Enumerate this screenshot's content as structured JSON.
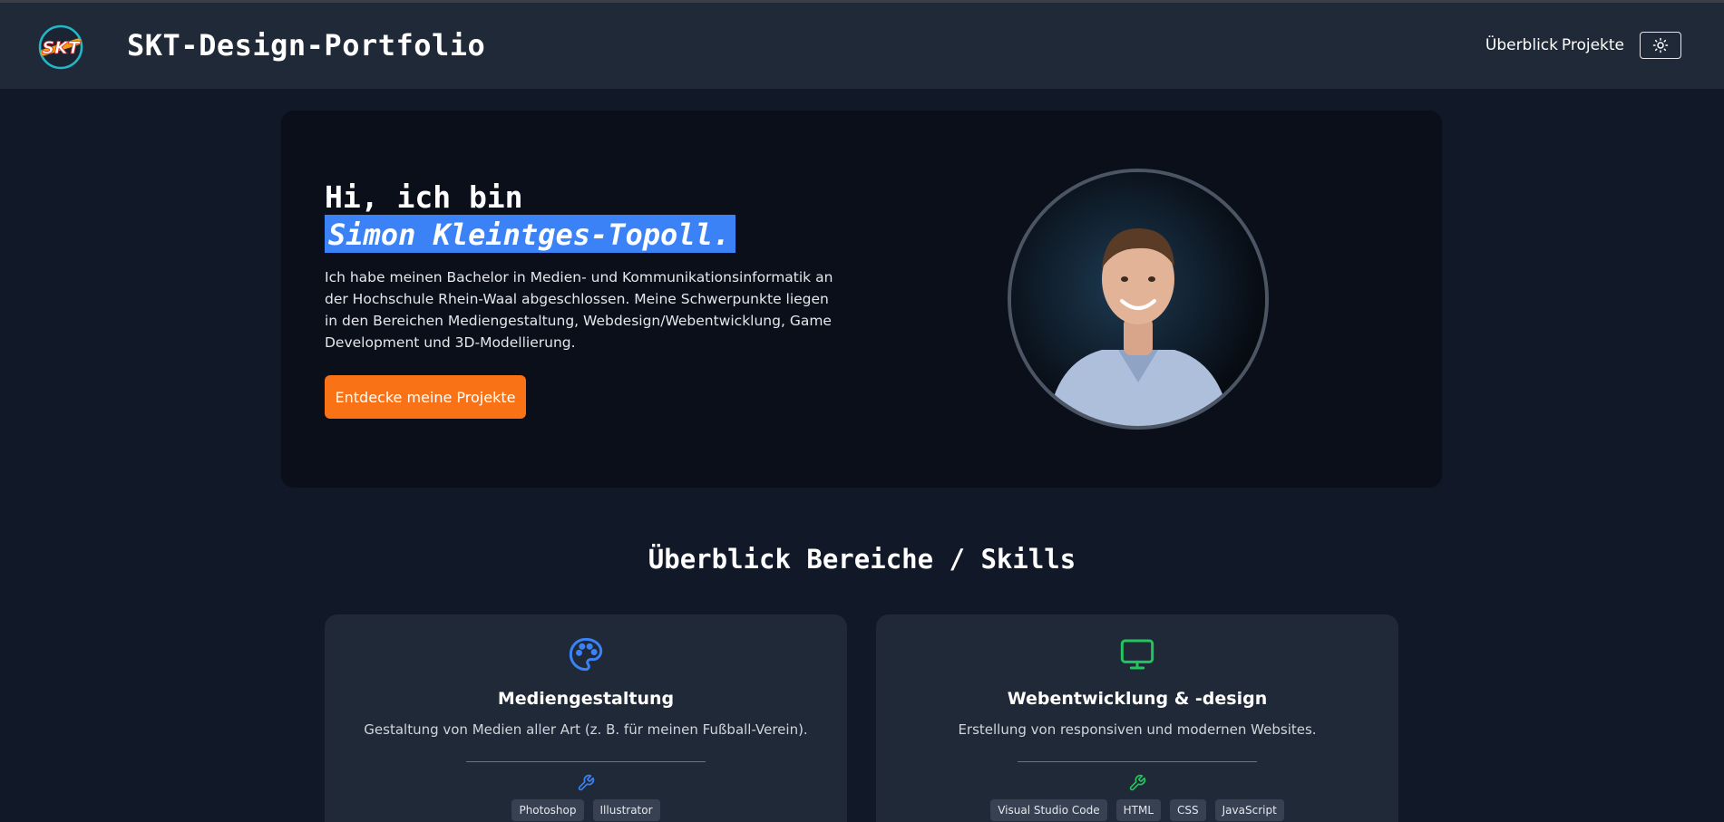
{
  "header": {
    "brand": "SKT-Design-Portfolio",
    "logo_text": "SKT",
    "nav": [
      {
        "label": "Überblick"
      },
      {
        "label": "Projekte"
      }
    ],
    "theme_toggle_icon": "sun-icon"
  },
  "hero": {
    "greeting": "Hi, ich bin",
    "name": "Simon Kleintges-Topoll.",
    "description": "Ich habe meinen Bachelor in Medien- und Kommunikationsinformatik an der Hochschule Rhein-Waal abgeschlossen. Meine Schwerpunkte liegen in den Bereichen Mediengestaltung, Webdesign/Webentwicklung, Game Development und 3D-Modellierung.",
    "cta_label": "Entdecke meine Projekte"
  },
  "skills": {
    "title": "Überblick Bereiche / Skills",
    "cards": [
      {
        "icon": "palette-icon",
        "title": "Mediengestaltung",
        "description": "Gestaltung von Medien aller Art (z. B. für meinen Fußball-Verein).",
        "tags": [
          "Photoshop",
          "Illustrator"
        ]
      },
      {
        "icon": "monitor-icon",
        "title": "Webentwicklung & -design",
        "description": "Erstellung von responsiven und modernen Websites.",
        "tags": [
          "Visual Studio Code",
          "HTML",
          "CSS",
          "JavaScript"
        ]
      }
    ]
  },
  "colors": {
    "accent_orange": "#f97316",
    "accent_blue": "#3b82f6",
    "accent_green": "#22c55e",
    "background": "#111827",
    "header_bg": "#1f2937"
  }
}
